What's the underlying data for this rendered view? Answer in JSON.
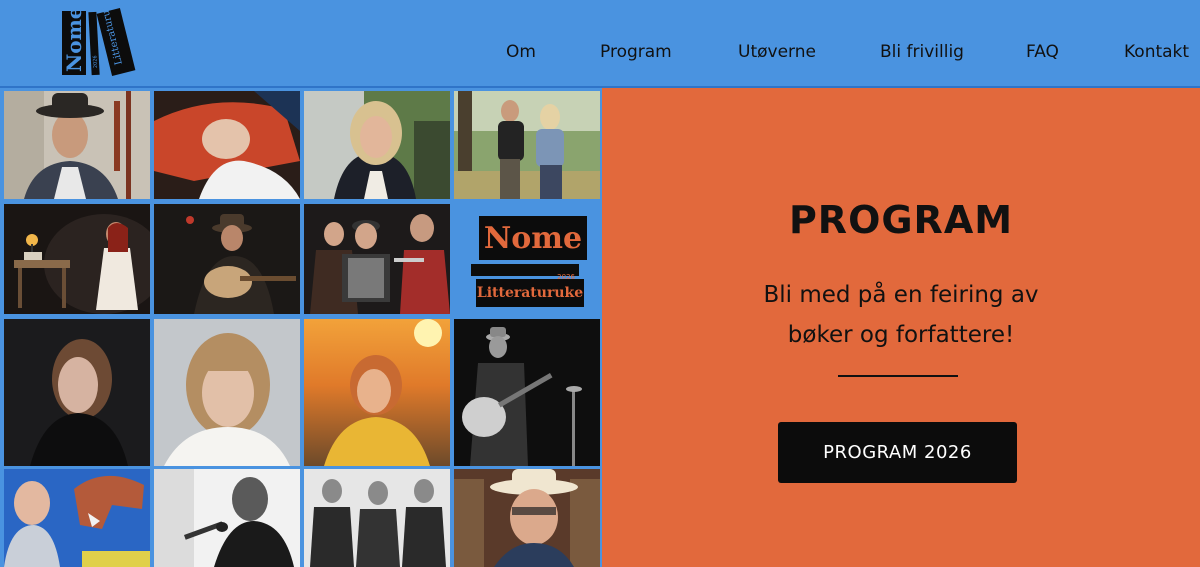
{
  "header": {
    "logo": {
      "name_text": "Nome",
      "sub_text": "Litteraturuke",
      "year_text": "2026"
    },
    "nav": [
      "Om",
      "Program",
      "Utøverne",
      "Bli frivillig",
      "FAQ",
      "Kontakt"
    ]
  },
  "grid": {
    "tile_logo": {
      "name_text": "Nome",
      "year_text": "2026",
      "sub_text": "Litteraturuke"
    }
  },
  "promo": {
    "title": "PROGRAM",
    "subtitle_line1": "Bli med på en feiring av",
    "subtitle_line2": "bøker og forfattere!",
    "button_label": "PROGRAM 2026"
  },
  "colors": {
    "header_bg": "#4a93e0",
    "promo_bg": "#e2693c",
    "button_bg": "#0c0c0c",
    "logo_accent": "#e2693c"
  }
}
